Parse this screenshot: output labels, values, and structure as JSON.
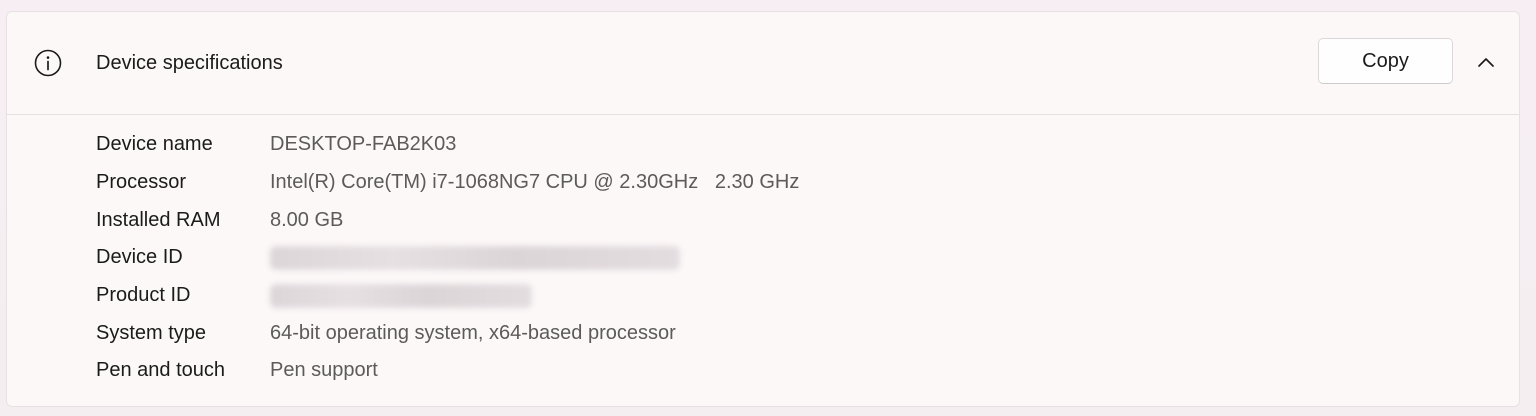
{
  "header": {
    "title": "Device specifications",
    "copy_label": "Copy"
  },
  "icons": {
    "info": "info-icon",
    "collapse": "chevron-up-icon"
  },
  "specs": [
    {
      "label": "Device name",
      "value": "DESKTOP-FAB2K03",
      "blurred": false
    },
    {
      "label": "Processor",
      "value": "Intel(R) Core(TM) i7-1068NG7 CPU @ 2.30GHz   2.30 GHz",
      "blurred": false
    },
    {
      "label": "Installed RAM",
      "value": "8.00 GB",
      "blurred": false
    },
    {
      "label": "Device ID",
      "value": "",
      "blurred": true
    },
    {
      "label": "Product ID",
      "value": "",
      "blurred": true
    },
    {
      "label": "System type",
      "value": "64-bit operating system, x64-based processor",
      "blurred": false
    },
    {
      "label": "Pen and touch",
      "value": "Pen support",
      "blurred": false
    }
  ]
}
